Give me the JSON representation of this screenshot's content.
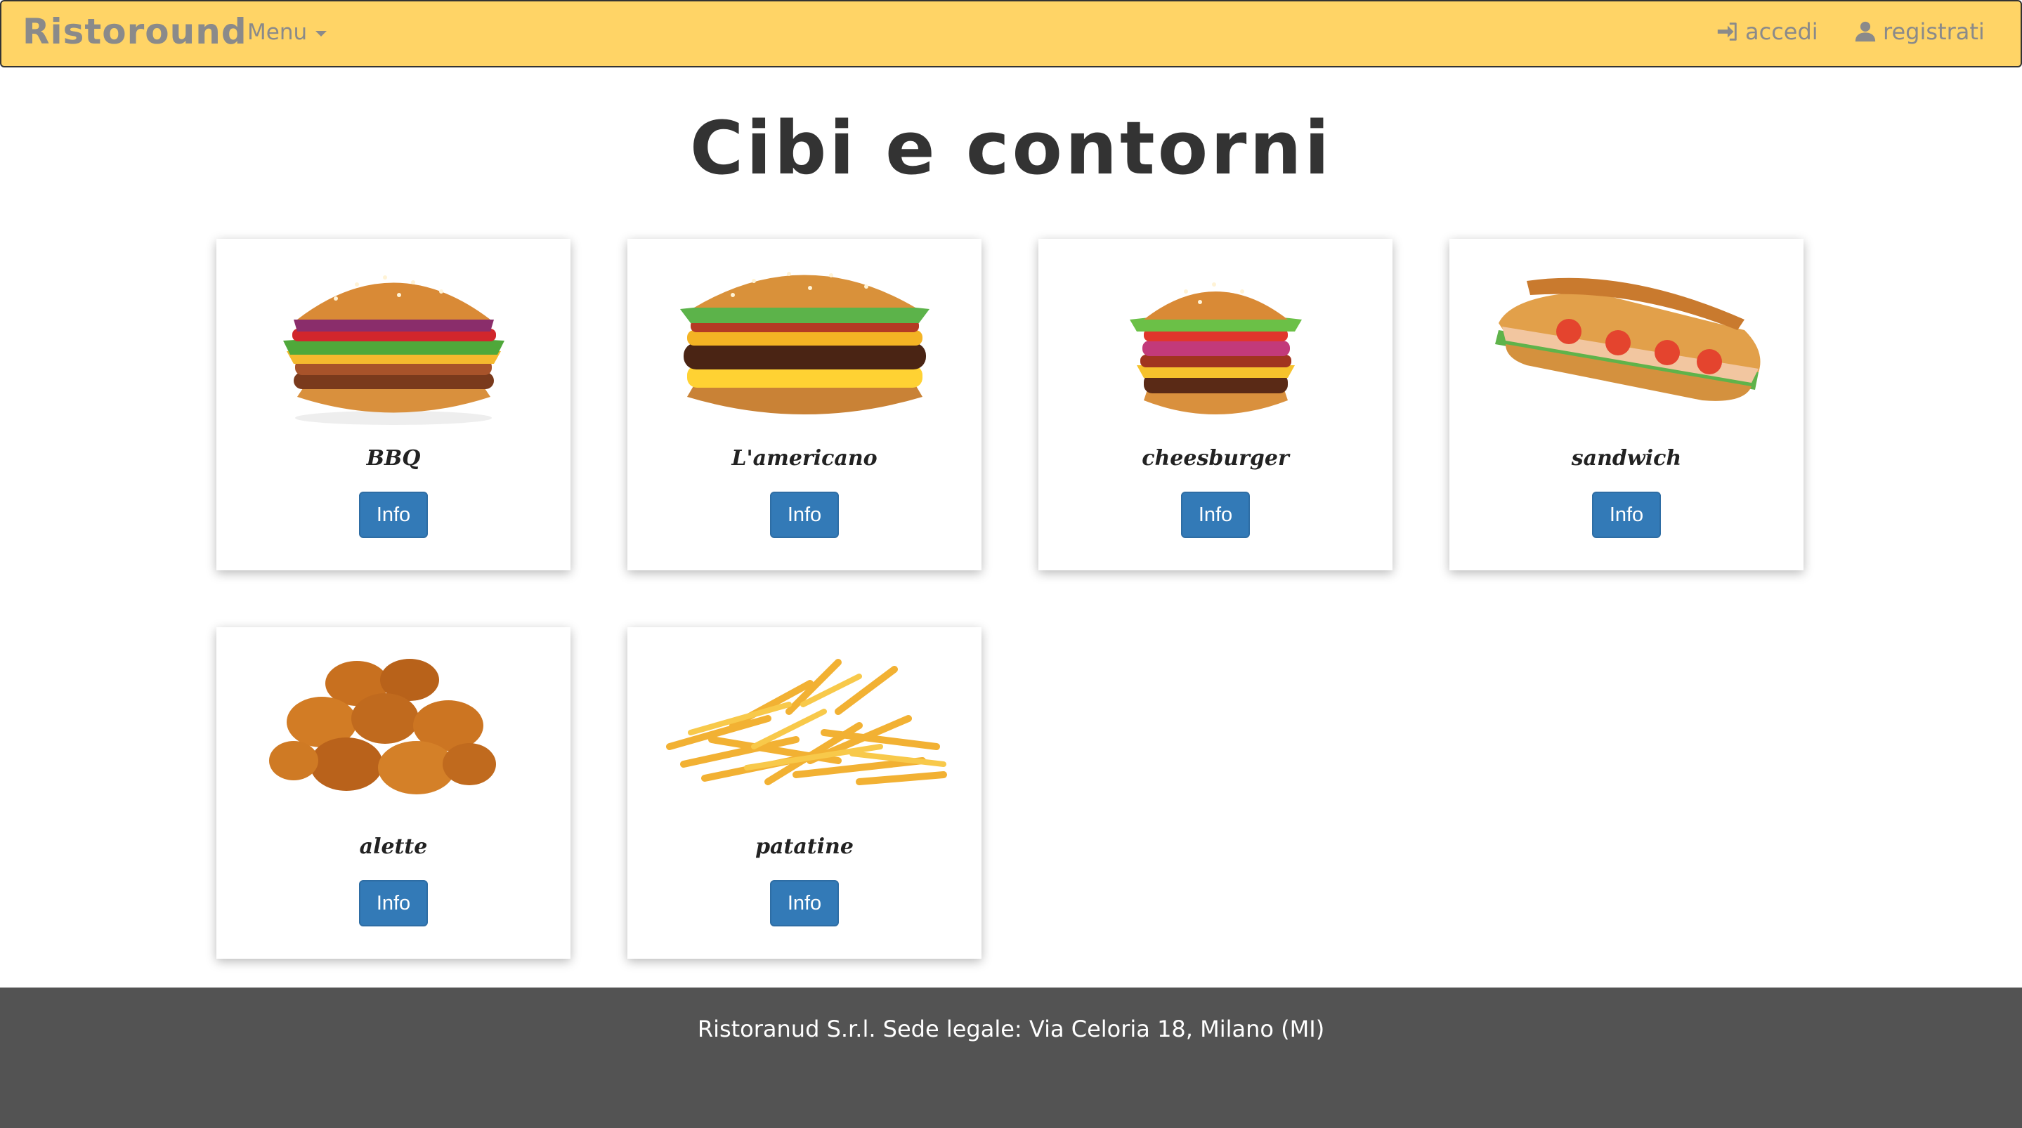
{
  "navbar": {
    "brand": "Ristoround",
    "menu_label": "Menu",
    "login_label": "accedi",
    "register_label": "registrati"
  },
  "page": {
    "title": "Cibi e contorni"
  },
  "items": [
    {
      "name": "BBQ",
      "button": "Info",
      "image": "bbq-burger"
    },
    {
      "name": "L'americano",
      "button": "Info",
      "image": "americano-burger"
    },
    {
      "name": "cheesburger",
      "button": "Info",
      "image": "cheeseburger"
    },
    {
      "name": "sandwich",
      "button": "Info",
      "image": "sandwich"
    },
    {
      "name": "alette",
      "button": "Info",
      "image": "fried-chicken-wings"
    },
    {
      "name": "patatine",
      "button": "Info",
      "image": "french-fries"
    }
  ],
  "footer": {
    "text": "Ristoranud S.r.l. Sede legale: Via Celoria 18, Milano (MI)"
  },
  "colors": {
    "navbar_bg": "#ffd466",
    "button_bg": "#337ab7",
    "footer_bg": "#535353"
  }
}
